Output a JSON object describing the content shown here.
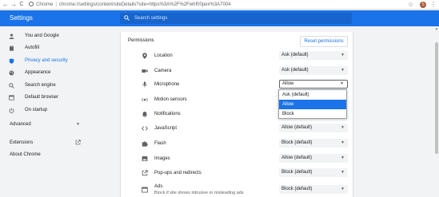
{
  "browser": {
    "back_glyph": "←",
    "forward_glyph": "→",
    "reload_glyph": "C",
    "site_label": "Chrome",
    "url": "chrome://settings/content/siteDetails?site=https%3A%2F%2Fwhf00pex%3A7004",
    "avatar_letter": "S"
  },
  "header": {
    "title": "Settings",
    "search_placeholder": "Search settings"
  },
  "sidebar": {
    "items": [
      {
        "label": "You and Google",
        "icon": "person-icon"
      },
      {
        "label": "Autofill",
        "icon": "clipboard-icon"
      },
      {
        "label": "Privacy and security",
        "icon": "shield-icon",
        "active": true
      },
      {
        "label": "Appearance",
        "icon": "palette-icon"
      },
      {
        "label": "Search engine",
        "icon": "search-icon"
      },
      {
        "label": "Default browser",
        "icon": "browser-icon"
      },
      {
        "label": "On startup",
        "icon": "power-icon"
      }
    ],
    "advanced_label": "Advanced",
    "extensions_label": "Extensions",
    "about_label": "About Chrome"
  },
  "permissions": {
    "heading": "Permissions",
    "reset_label": "Reset permissions",
    "rows": [
      {
        "label": "Location",
        "value": "Ask (default)",
        "icon": "location-icon"
      },
      {
        "label": "Camera",
        "value": "Ask (default)",
        "icon": "camera-icon"
      },
      {
        "label": "Microphone",
        "value": "Allow",
        "icon": "microphone-icon"
      },
      {
        "label": "Motion sensors",
        "value": "",
        "icon": "motion-sensors-icon"
      },
      {
        "label": "Notifications",
        "value": "",
        "icon": "bell-icon"
      },
      {
        "label": "JavaScript",
        "value": "Allow (default)",
        "icon": "code-icon"
      },
      {
        "label": "Flash",
        "value": "Block (default)",
        "icon": "puzzle-icon"
      },
      {
        "label": "Images",
        "value": "Allow (default)",
        "icon": "image-icon"
      },
      {
        "label": "Pop-ups and redirects",
        "value": "Block (default)",
        "icon": "popup-icon"
      },
      {
        "label": "Ads",
        "sublabel": "Block if site shows intrusive or misleading ads",
        "value": "Block (default)",
        "icon": "ads-icon"
      }
    ],
    "dropdown_options": [
      "Ask (default)",
      "Allow",
      "Block"
    ],
    "dropdown_selected": "Allow"
  },
  "colors": {
    "accent": "#1a73e8",
    "header_bg": "#1a73e8",
    "page_bg": "#f1f3f4"
  }
}
